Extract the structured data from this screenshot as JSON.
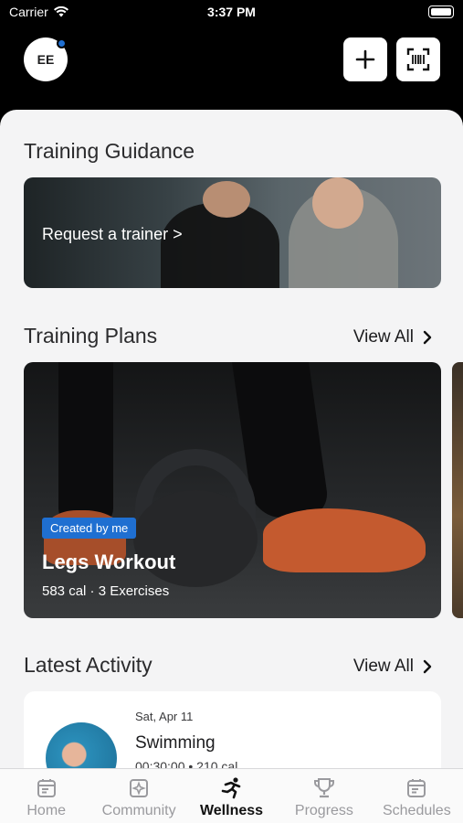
{
  "status_bar": {
    "carrier": "Carrier",
    "time": "3:37 PM"
  },
  "header": {
    "avatar_initials": "EE"
  },
  "training_guidance": {
    "title": "Training Guidance",
    "card_label": "Request a trainer >"
  },
  "training_plans": {
    "title": "Training Plans",
    "view_all": "View All",
    "cards": [
      {
        "badge": "Created by me",
        "title": "Legs Workout",
        "meta": "583 cal · 3 Exercises"
      }
    ]
  },
  "latest_activity": {
    "title": "Latest Activity",
    "view_all": "View All",
    "items": [
      {
        "date": "Sat, Apr 11",
        "name": "Swimming",
        "stats": "00:30:00 • 210 cal"
      }
    ]
  },
  "tab_bar": {
    "tabs": [
      {
        "label": "Home",
        "icon": "home-icon"
      },
      {
        "label": "Community",
        "icon": "community-icon"
      },
      {
        "label": "Wellness",
        "icon": "wellness-icon",
        "active": true
      },
      {
        "label": "Progress",
        "icon": "trophy-icon"
      },
      {
        "label": "Schedules",
        "icon": "schedules-icon"
      }
    ]
  },
  "colors": {
    "accent": "#1f6fd1",
    "background": "#000000",
    "sheet": "#f4f4f5"
  }
}
